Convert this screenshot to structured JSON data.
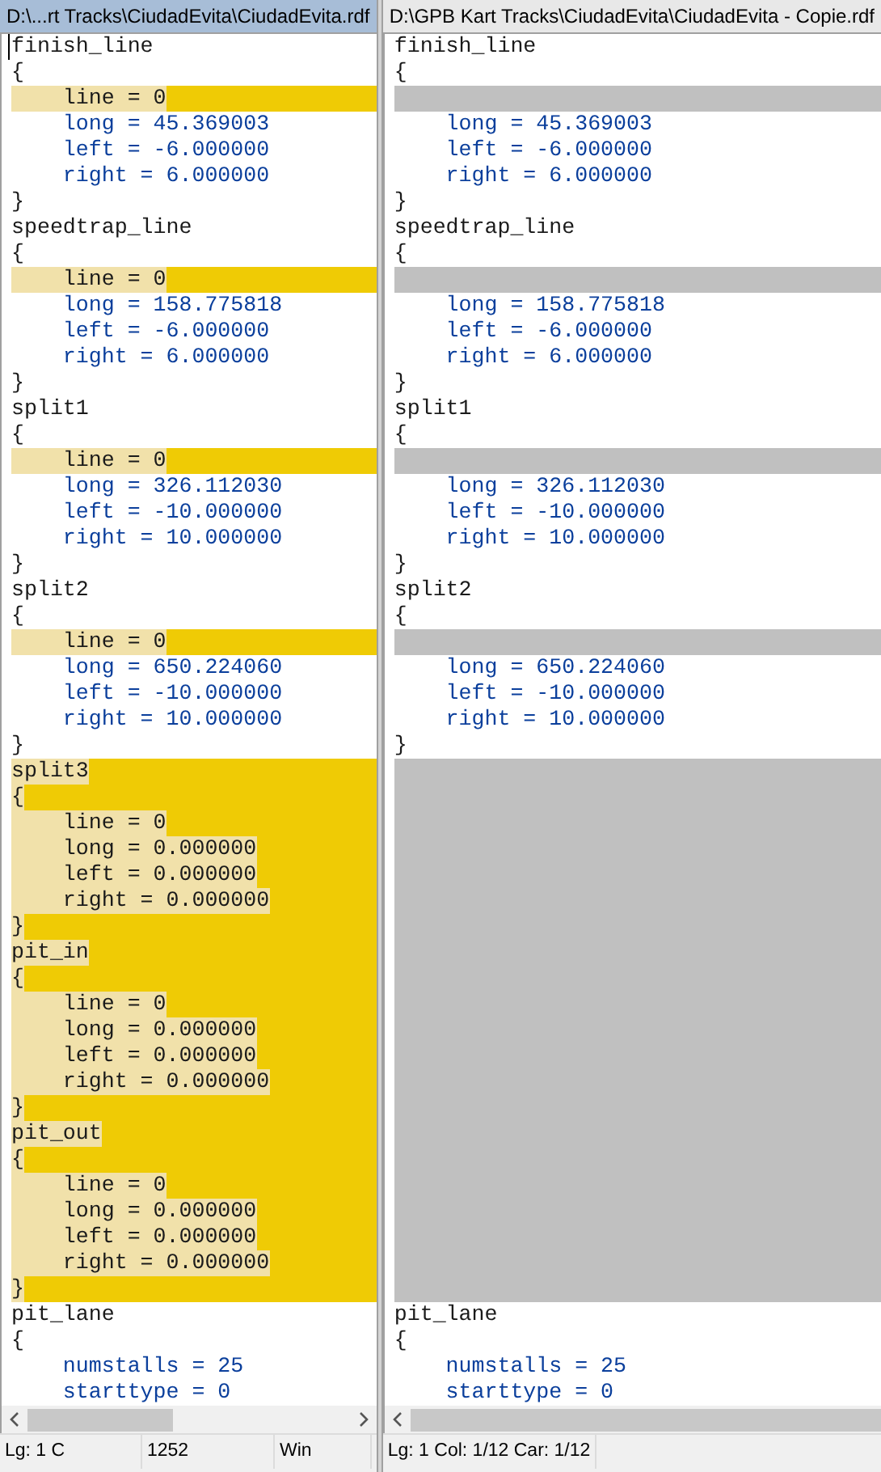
{
  "panes": [
    {
      "title": "D:\\...rt Tracks\\CiudadEvita\\CiudadEvita.rdf",
      "active": true,
      "status": [
        "Lg: 1  C",
        "1252",
        "Win"
      ]
    },
    {
      "title": "D:\\GPB Kart Tracks\\CiudadEvita\\CiudadEvita - Copie.rdf",
      "active": false,
      "status": [
        "Lg: 1  Col: 1/12  Car: 1/12"
      ]
    }
  ],
  "rows": [
    {
      "left": {
        "kind": "same",
        "text": "finish_line"
      },
      "right": {
        "kind": "same",
        "text": "finish_line"
      }
    },
    {
      "left": {
        "kind": "same",
        "text": "{"
      },
      "right": {
        "kind": "same",
        "text": "{"
      }
    },
    {
      "left": {
        "kind": "diff",
        "text": "    line = 0"
      },
      "right": {
        "kind": "blank"
      }
    },
    {
      "left": {
        "kind": "same",
        "text": "    long = 45.369003"
      },
      "right": {
        "kind": "same",
        "text": "    long = 45.369003"
      }
    },
    {
      "left": {
        "kind": "same",
        "text": "    left = -6.000000"
      },
      "right": {
        "kind": "same",
        "text": "    left = -6.000000"
      }
    },
    {
      "left": {
        "kind": "same",
        "text": "    right = 6.000000"
      },
      "right": {
        "kind": "same",
        "text": "    right = 6.000000"
      }
    },
    {
      "left": {
        "kind": "same",
        "text": "}"
      },
      "right": {
        "kind": "same",
        "text": "}"
      }
    },
    {
      "left": {
        "kind": "same",
        "text": "speedtrap_line"
      },
      "right": {
        "kind": "same",
        "text": "speedtrap_line"
      }
    },
    {
      "left": {
        "kind": "same",
        "text": "{"
      },
      "right": {
        "kind": "same",
        "text": "{"
      }
    },
    {
      "left": {
        "kind": "diff",
        "text": "    line = 0"
      },
      "right": {
        "kind": "blank"
      }
    },
    {
      "left": {
        "kind": "same",
        "text": "    long = 158.775818"
      },
      "right": {
        "kind": "same",
        "text": "    long = 158.775818"
      }
    },
    {
      "left": {
        "kind": "same",
        "text": "    left = -6.000000"
      },
      "right": {
        "kind": "same",
        "text": "    left = -6.000000"
      }
    },
    {
      "left": {
        "kind": "same",
        "text": "    right = 6.000000"
      },
      "right": {
        "kind": "same",
        "text": "    right = 6.000000"
      }
    },
    {
      "left": {
        "kind": "same",
        "text": "}"
      },
      "right": {
        "kind": "same",
        "text": "}"
      }
    },
    {
      "left": {
        "kind": "same",
        "text": "split1"
      },
      "right": {
        "kind": "same",
        "text": "split1"
      }
    },
    {
      "left": {
        "kind": "same",
        "text": "{"
      },
      "right": {
        "kind": "same",
        "text": "{"
      }
    },
    {
      "left": {
        "kind": "diff",
        "text": "    line = 0"
      },
      "right": {
        "kind": "blank"
      }
    },
    {
      "left": {
        "kind": "same",
        "text": "    long = 326.112030"
      },
      "right": {
        "kind": "same",
        "text": "    long = 326.112030"
      }
    },
    {
      "left": {
        "kind": "same",
        "text": "    left = -10.000000"
      },
      "right": {
        "kind": "same",
        "text": "    left = -10.000000"
      }
    },
    {
      "left": {
        "kind": "same",
        "text": "    right = 10.000000"
      },
      "right": {
        "kind": "same",
        "text": "    right = 10.000000"
      }
    },
    {
      "left": {
        "kind": "same",
        "text": "}"
      },
      "right": {
        "kind": "same",
        "text": "}"
      }
    },
    {
      "left": {
        "kind": "same",
        "text": "split2"
      },
      "right": {
        "kind": "same",
        "text": "split2"
      }
    },
    {
      "left": {
        "kind": "same",
        "text": "{"
      },
      "right": {
        "kind": "same",
        "text": "{"
      }
    },
    {
      "left": {
        "kind": "diff",
        "text": "    line = 0"
      },
      "right": {
        "kind": "blank"
      }
    },
    {
      "left": {
        "kind": "same",
        "text": "    long = 650.224060"
      },
      "right": {
        "kind": "same",
        "text": "    long = 650.224060"
      }
    },
    {
      "left": {
        "kind": "same",
        "text": "    left = -10.000000"
      },
      "right": {
        "kind": "same",
        "text": "    left = -10.000000"
      }
    },
    {
      "left": {
        "kind": "same",
        "text": "    right = 10.000000"
      },
      "right": {
        "kind": "same",
        "text": "    right = 10.000000"
      }
    },
    {
      "left": {
        "kind": "same",
        "text": "}"
      },
      "right": {
        "kind": "same",
        "text": "}"
      }
    },
    {
      "left": {
        "kind": "diff",
        "text": "split3"
      },
      "right": {
        "kind": "blank"
      }
    },
    {
      "left": {
        "kind": "diff",
        "text": "{"
      },
      "right": {
        "kind": "blank"
      }
    },
    {
      "left": {
        "kind": "diff",
        "text": "    line = 0"
      },
      "right": {
        "kind": "blank"
      }
    },
    {
      "left": {
        "kind": "diff",
        "text": "    long = 0.000000"
      },
      "right": {
        "kind": "blank"
      }
    },
    {
      "left": {
        "kind": "diff",
        "text": "    left = 0.000000"
      },
      "right": {
        "kind": "blank"
      }
    },
    {
      "left": {
        "kind": "diff",
        "text": "    right = 0.000000"
      },
      "right": {
        "kind": "blank"
      }
    },
    {
      "left": {
        "kind": "diff",
        "text": "}"
      },
      "right": {
        "kind": "blank"
      }
    },
    {
      "left": {
        "kind": "diff",
        "text": "pit_in"
      },
      "right": {
        "kind": "blank"
      }
    },
    {
      "left": {
        "kind": "diff",
        "text": "{"
      },
      "right": {
        "kind": "blank"
      }
    },
    {
      "left": {
        "kind": "diff",
        "text": "    line = 0"
      },
      "right": {
        "kind": "blank"
      }
    },
    {
      "left": {
        "kind": "diff",
        "text": "    long = 0.000000"
      },
      "right": {
        "kind": "blank"
      }
    },
    {
      "left": {
        "kind": "diff",
        "text": "    left = 0.000000"
      },
      "right": {
        "kind": "blank"
      }
    },
    {
      "left": {
        "kind": "diff",
        "text": "    right = 0.000000"
      },
      "right": {
        "kind": "blank"
      }
    },
    {
      "left": {
        "kind": "diff",
        "text": "}"
      },
      "right": {
        "kind": "blank"
      }
    },
    {
      "left": {
        "kind": "diff",
        "text": "pit_out"
      },
      "right": {
        "kind": "blank"
      }
    },
    {
      "left": {
        "kind": "diff",
        "text": "{"
      },
      "right": {
        "kind": "blank"
      }
    },
    {
      "left": {
        "kind": "diff",
        "text": "    line = 0"
      },
      "right": {
        "kind": "blank"
      }
    },
    {
      "left": {
        "kind": "diff",
        "text": "    long = 0.000000"
      },
      "right": {
        "kind": "blank"
      }
    },
    {
      "left": {
        "kind": "diff",
        "text": "    left = 0.000000"
      },
      "right": {
        "kind": "blank"
      }
    },
    {
      "left": {
        "kind": "diff",
        "text": "    right = 0.000000"
      },
      "right": {
        "kind": "blank"
      }
    },
    {
      "left": {
        "kind": "diff",
        "text": "}"
      },
      "right": {
        "kind": "blank"
      }
    },
    {
      "left": {
        "kind": "same",
        "text": "pit_lane"
      },
      "right": {
        "kind": "same",
        "text": "pit_lane"
      }
    },
    {
      "left": {
        "kind": "same",
        "text": "{"
      },
      "right": {
        "kind": "same",
        "text": "{"
      }
    },
    {
      "left": {
        "kind": "same",
        "text": "    numstalls = 25"
      },
      "right": {
        "kind": "same",
        "text": "    numstalls = 25"
      }
    },
    {
      "left": {
        "kind": "same",
        "text": "    starttype = 0"
      },
      "right": {
        "kind": "same",
        "text": "    starttype = 0"
      }
    }
  ]
}
